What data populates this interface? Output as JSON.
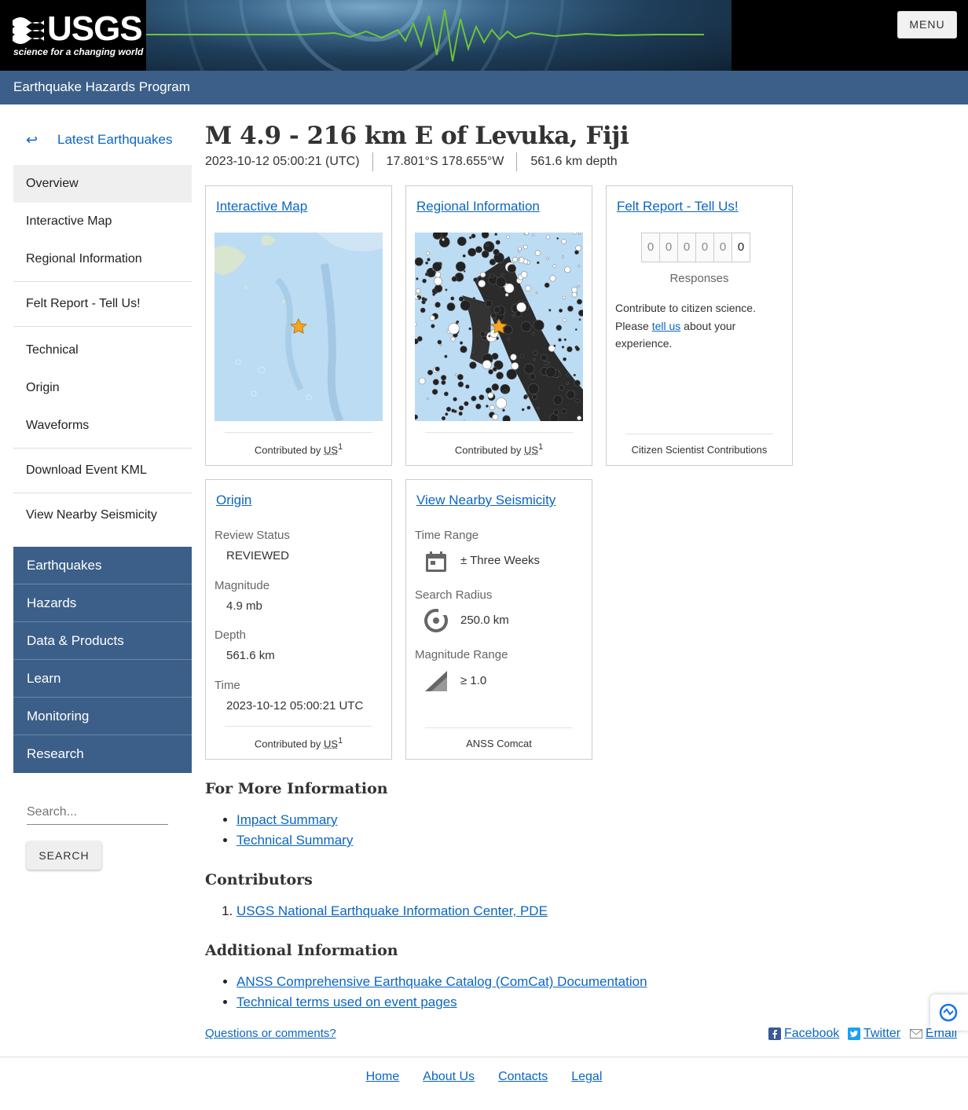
{
  "header": {
    "logo_text": "USGS",
    "logo_tagline": "science for a changing world",
    "menu_label": "MENU",
    "program_title": "Earthquake Hazards Program"
  },
  "sidebar": {
    "back_label": "Latest Earthquakes",
    "items": [
      "Overview",
      "Interactive Map",
      "Regional Information",
      "Felt Report - Tell Us!",
      "Technical",
      "Origin",
      "Waveforms",
      "Download Event KML",
      "View Nearby Seismicity"
    ],
    "active": "Overview",
    "site_nav": [
      "Earthquakes",
      "Hazards",
      "Data & Products",
      "Learn",
      "Monitoring",
      "Research"
    ],
    "search_placeholder": "Search...",
    "search_button": "SEARCH"
  },
  "event": {
    "title": "M 4.9 - 216 km E of Levuka, Fiji",
    "time": "2023-10-12 05:00:21 (UTC)",
    "location": "17.801°S 178.655°W",
    "depth": "561.6 km depth"
  },
  "cards": {
    "interactive_map": {
      "title": "Interactive Map",
      "contributed_prefix": "Contributed by",
      "contributor": "US",
      "sup": "1"
    },
    "regional": {
      "title": "Regional Information",
      "contributed_prefix": "Contributed by",
      "contributor": "US",
      "sup": "1"
    },
    "felt": {
      "title": "Felt Report - Tell Us!",
      "digits": [
        "0",
        "0",
        "0",
        "0",
        "0",
        "0"
      ],
      "responses_label": "Responses",
      "text_before": "Contribute to citizen science. Please ",
      "link": "tell us",
      "text_after": " about your experience.",
      "footer": "Citizen Scientist Contributions"
    },
    "origin": {
      "title": "Origin",
      "review_label": "Review Status",
      "review_value": "REVIEWED",
      "mag_label": "Magnitude",
      "mag_value": "4.9 mb",
      "depth_label": "Depth",
      "depth_value": "561.6 km",
      "time_label": "Time",
      "time_value": "2023-10-12 05:00:21 UTC",
      "contributed_prefix": "Contributed by",
      "contributor": "US",
      "sup": "1"
    },
    "nearby": {
      "title": "View Nearby Seismicity",
      "time_label": "Time Range",
      "time_value": "± Three Weeks",
      "radius_label": "Search Radius",
      "radius_value": "250.0 km",
      "mag_label": "Magnitude Range",
      "mag_value": "≥ 1.0",
      "footer": "ANSS Comcat"
    }
  },
  "more_info": {
    "heading": "For More Information",
    "links": [
      "Impact Summary",
      "Technical Summary"
    ]
  },
  "contributors": {
    "heading": "Contributors",
    "items": [
      "USGS National Earthquake Information Center, PDE"
    ]
  },
  "additional": {
    "heading": "Additional Information",
    "links": [
      "ANSS Comprehensive Earthquake Catalog (ComCat) Documentation",
      "Technical terms used on event pages"
    ]
  },
  "footer": {
    "questions": "Questions or comments?",
    "social": [
      "Facebook",
      "Twitter",
      "Email"
    ],
    "links": [
      "Home",
      "About Us",
      "Contacts",
      "Legal"
    ]
  },
  "colors": {
    "nav_blue": "#3b5f88",
    "link": "#0b66c2"
  }
}
